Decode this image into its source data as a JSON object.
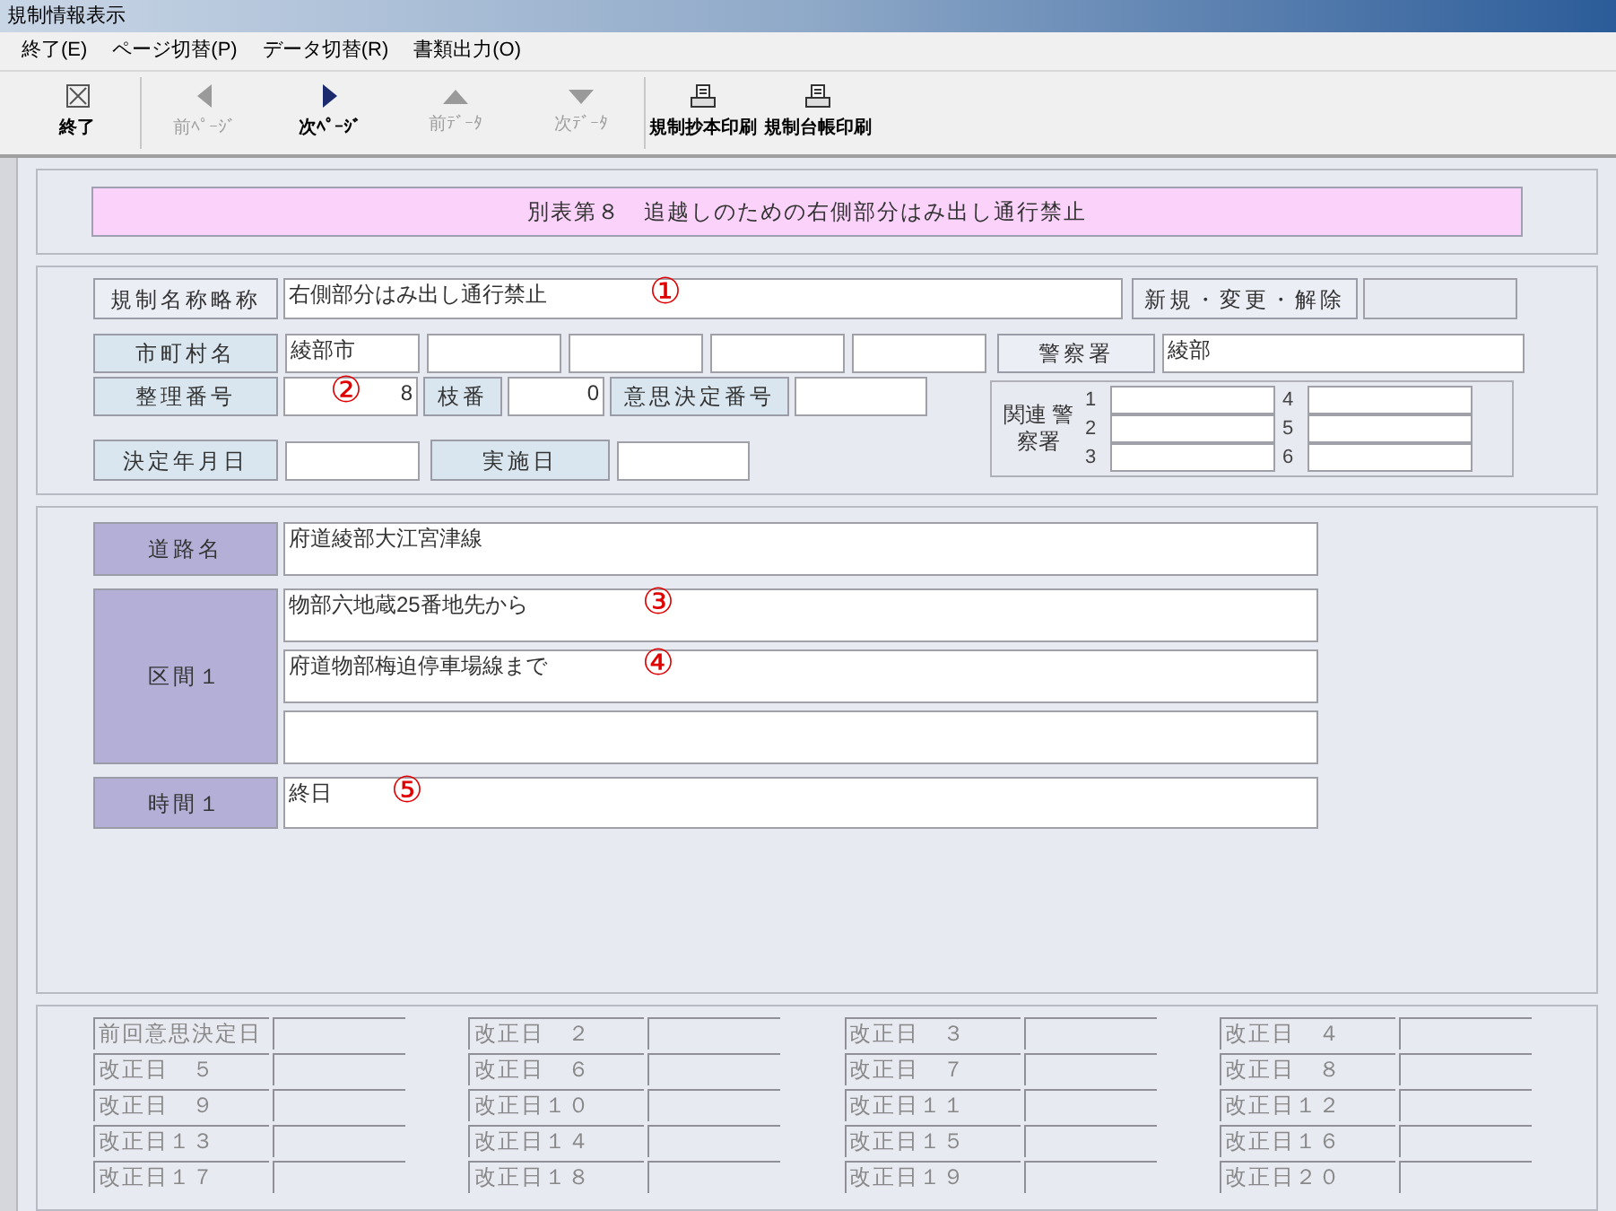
{
  "window": {
    "title": "規制情報表示"
  },
  "menu": [
    "終了(E)",
    "ページ切替(P)",
    "データ切替(R)",
    "書類出力(O)"
  ],
  "toolbar": [
    [
      {
        "label": "終了",
        "kind": "close",
        "disabled": false
      }
    ],
    [
      {
        "label": "前ﾍﾟｰｼﾞ",
        "kind": "left",
        "disabled": true
      },
      {
        "label": "次ﾍﾟｰｼﾞ",
        "kind": "right",
        "disabled": false
      },
      {
        "label": "前ﾃﾞｰﾀ",
        "kind": "up",
        "disabled": true
      },
      {
        "label": "次ﾃﾞｰﾀ",
        "kind": "down",
        "disabled": true
      }
    ],
    [
      {
        "label": "規制抄本印刷",
        "kind": "print",
        "disabled": false
      },
      {
        "label": "規制台帳印刷",
        "kind": "print",
        "disabled": false
      }
    ]
  ],
  "header": "別表第８　追越しのための右側部分はみ出し通行禁止",
  "regulation": {
    "label": "規制名称略称",
    "value": "右側部分はみ出し通行禁止",
    "marker": "①",
    "status_label": "新規・変更・解除"
  },
  "municipality": {
    "label": "市町村名",
    "values": [
      "綾部市"
    ]
  },
  "police": {
    "label": "警察署",
    "value": "綾部"
  },
  "number": {
    "label": "整理番号",
    "value": "8",
    "marker": "②"
  },
  "branch": {
    "label": "枝番",
    "value": "0"
  },
  "decision_no": {
    "label": "意思決定番号"
  },
  "related": {
    "label": "関連 警察署",
    "numbers": [
      "1",
      "2",
      "3",
      "4",
      "5",
      "6"
    ]
  },
  "decision_date": {
    "label": "決定年月日"
  },
  "effective_date": {
    "label": "実施日"
  },
  "road": {
    "label": "道路名",
    "value": "府道綾部大江宮津線"
  },
  "section": {
    "label": "区間１",
    "lines": [
      {
        "value": "物部六地蔵25番地先から",
        "marker": "③"
      },
      {
        "value": "府道物部梅迫停車場線まで",
        "marker": "④"
      }
    ]
  },
  "time": {
    "label": "時間１",
    "value": "終日",
    "marker": "⑤"
  },
  "history": [
    "前回意思決定日",
    "改正日　２",
    "改正日　３",
    "改正日　４",
    "改正日　５",
    "改正日　６",
    "改正日　７",
    "改正日　８",
    "改正日　９",
    "改正日１０",
    "改正日１１",
    "改正日１２",
    "改正日１３",
    "改正日１４",
    "改正日１５",
    "改正日１６",
    "改正日１７",
    "改正日１８",
    "改正日１９",
    "改正日２０"
  ]
}
